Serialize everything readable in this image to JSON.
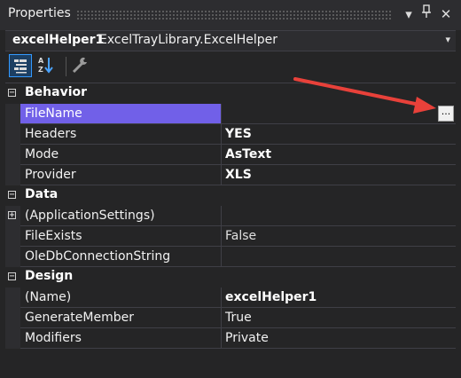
{
  "window": {
    "title": "Properties"
  },
  "title_buttons": {
    "dropdown": "▾",
    "pin": "📌",
    "close": "✕"
  },
  "object": {
    "name": "excelHelper1",
    "type": "ExcelTrayLibrary.ExcelHelper",
    "dropdown": "▾"
  },
  "toolbar": {
    "buttons": [
      "categorized",
      "alphabetical",
      "properties"
    ]
  },
  "grid": {
    "categories": [
      {
        "label": "Behavior",
        "expander": "−"
      },
      {
        "label": "Data",
        "expander": "−"
      },
      {
        "label": "Design",
        "expander": "−"
      }
    ],
    "rows": [
      {
        "name": "FileName",
        "value": "",
        "ellipsis": "..."
      },
      {
        "name": "Headers",
        "value": "YES"
      },
      {
        "name": "Mode",
        "value": "AsText"
      },
      {
        "name": "Provider",
        "value": "XLS"
      },
      {
        "name": "(ApplicationSettings)",
        "value": "",
        "expander": "+"
      },
      {
        "name": "FileExists",
        "value": "False"
      },
      {
        "name": "OleDbConnectionString",
        "value": ""
      },
      {
        "name": "(Name)",
        "value": "excelHelper1"
      },
      {
        "name": "GenerateMember",
        "value": "True"
      },
      {
        "name": "Modifiers",
        "value": "Private"
      }
    ]
  },
  "annotation": {
    "arrow_color": "#e8413a"
  },
  "colors": {
    "selection": "#7160e8",
    "background": "#252526"
  }
}
